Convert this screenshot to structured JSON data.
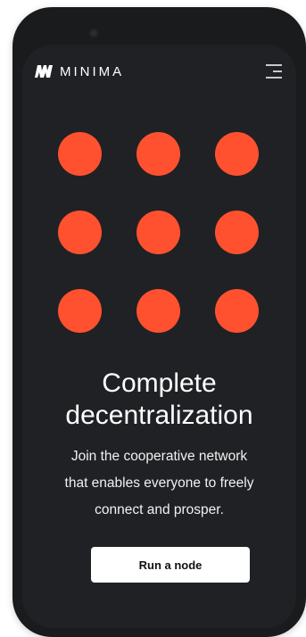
{
  "device": {
    "camera_icon": "front-camera"
  },
  "header": {
    "logo_icon": "minima-logo-mark",
    "brand_name": "MINIMA",
    "menu_icon": "hamburger-menu"
  },
  "hero": {
    "dot_color": "#ff512f",
    "dots": [
      1,
      2,
      3,
      4,
      5,
      6,
      7,
      8,
      9
    ],
    "headline_line1": "Complete",
    "headline_line2": "decentralization",
    "subtext_line1": "Join the cooperative network",
    "subtext_line2": "that enables everyone to freely",
    "subtext_line3": "connect and prosper.",
    "cta_label": "Run a node"
  },
  "colors": {
    "background": "#202124",
    "accent": "#ff512f",
    "text": "#ffffff",
    "button_bg": "#ffffff",
    "button_text": "#111111"
  }
}
